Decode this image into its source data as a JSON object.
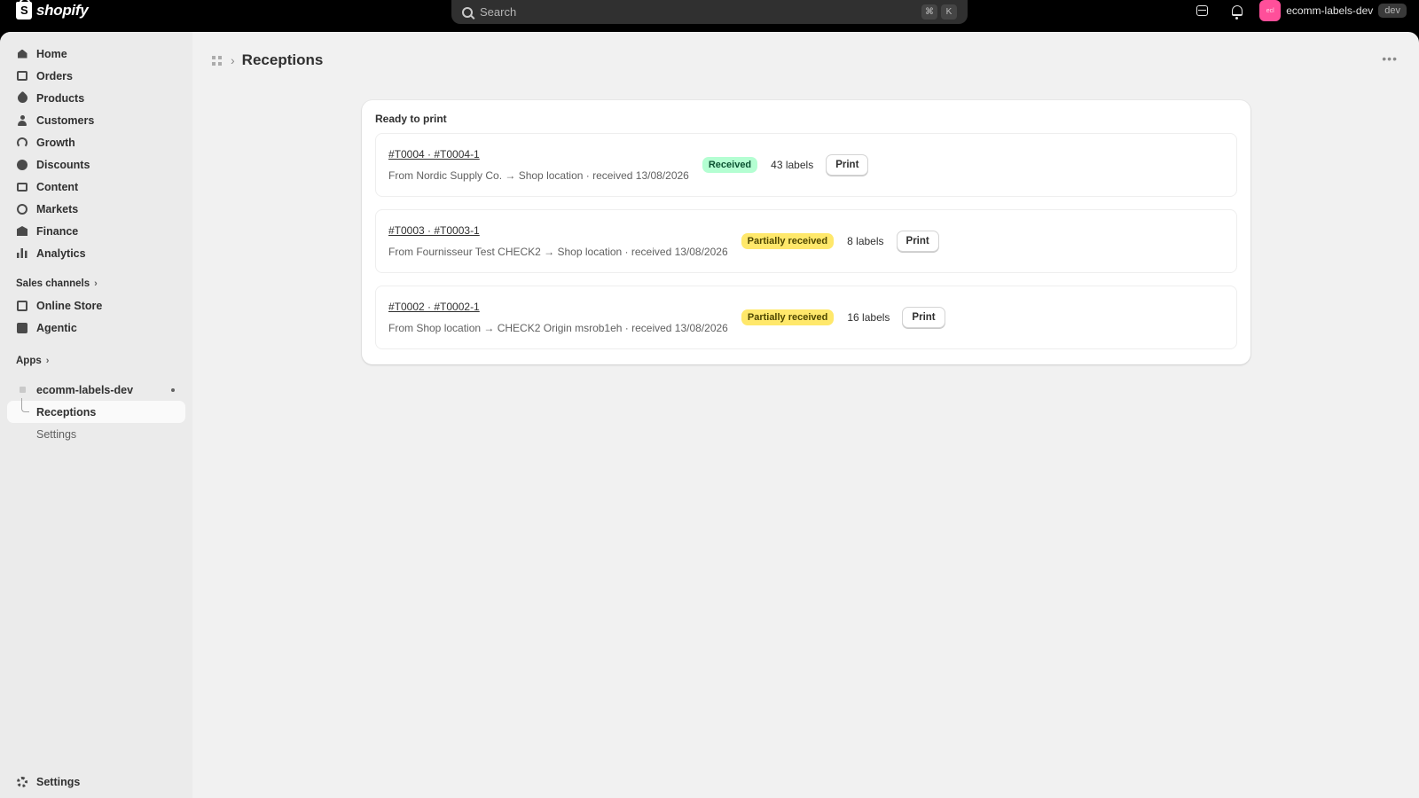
{
  "topbar": {
    "logo_text": "shopify",
    "search_placeholder": "Search",
    "shortcut_keys": [
      "⌘",
      "K"
    ],
    "avatar_initials": "ecl",
    "store_name": "ecomm-labels-dev",
    "store_badge": "dev"
  },
  "sidebar": {
    "items": [
      {
        "label": "Home",
        "icon": "home-icon"
      },
      {
        "label": "Orders",
        "icon": "orders-icon"
      },
      {
        "label": "Products",
        "icon": "tag-icon"
      },
      {
        "label": "Customers",
        "icon": "person-icon"
      },
      {
        "label": "Growth",
        "icon": "gauge-icon"
      },
      {
        "label": "Discounts",
        "icon": "discount-icon"
      },
      {
        "label": "Content",
        "icon": "content-icon"
      },
      {
        "label": "Markets",
        "icon": "globe-icon"
      },
      {
        "label": "Finance",
        "icon": "bank-icon"
      },
      {
        "label": "Analytics",
        "icon": "bar-chart-icon"
      }
    ],
    "sales_channels_label": "Sales channels",
    "sales_channels": [
      {
        "label": "Online Store",
        "icon": "store-icon"
      },
      {
        "label": "Agentic",
        "icon": "agent-icon"
      }
    ],
    "apps_label": "Apps",
    "app_name": "ecomm-labels-dev",
    "app_subitems": [
      {
        "label": "Receptions",
        "active": true
      },
      {
        "label": "Settings",
        "active": false
      }
    ],
    "settings_label": "Settings"
  },
  "page": {
    "title": "Receptions",
    "more_label": "•••"
  },
  "card": {
    "title": "Ready to print",
    "rows": [
      {
        "link": "#T0004 · #T0004-1",
        "subtitle": "From Nordic Supply Co. → Shop location · received 13/08/2026",
        "status": "Received",
        "status_bg": "#b4fed2",
        "status_fg": "#0c5132",
        "labels": "43 labels",
        "action": "Print"
      },
      {
        "link": "#T0003 · #T0003-1",
        "subtitle": "From Fournisseur Test CHECK2 → Shop location · received 13/08/2026",
        "status": "Partially received",
        "status_bg": "#ffe86b",
        "status_fg": "#4f4700",
        "labels": "8 labels",
        "action": "Print"
      },
      {
        "link": "#T0002 · #T0002-1",
        "subtitle": "From Shop location → CHECK2 Origin msrob1eh · received 13/08/2026",
        "status": "Partially received",
        "status_bg": "#ffe86b",
        "status_fg": "#4f4700",
        "labels": "16 labels",
        "action": "Print"
      }
    ]
  }
}
